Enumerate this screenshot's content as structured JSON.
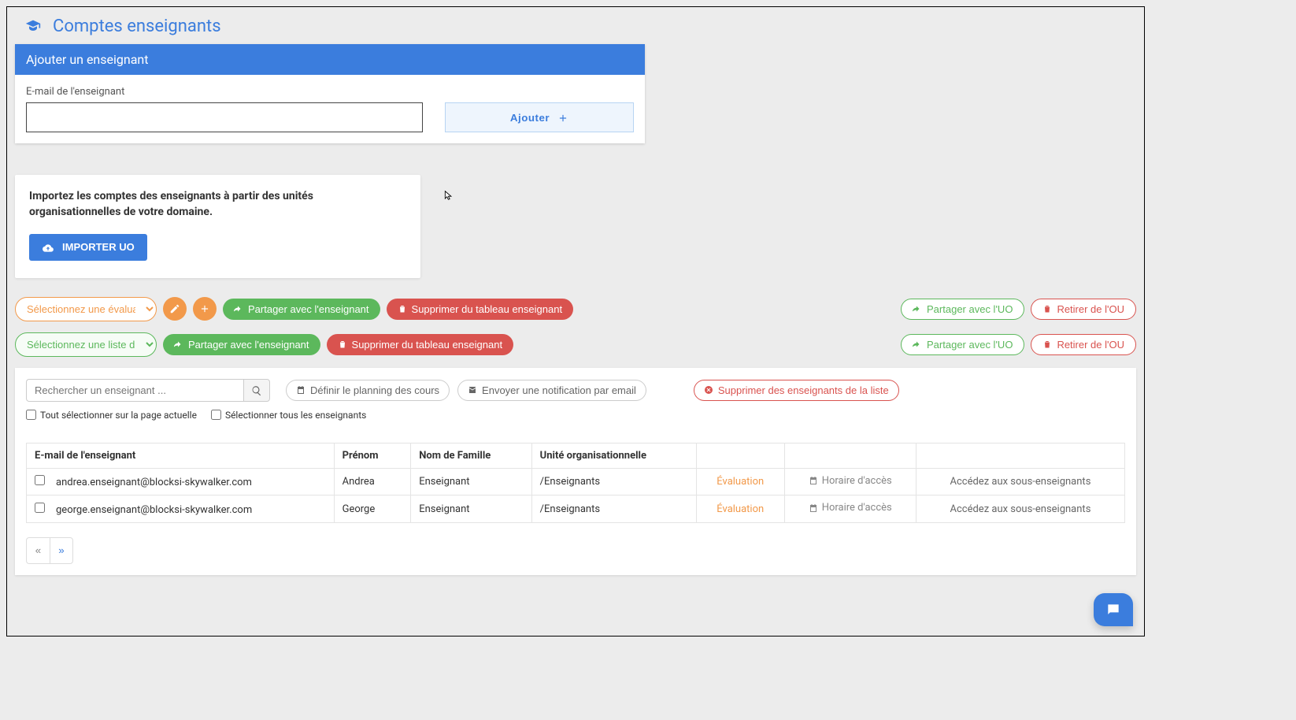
{
  "page": {
    "title": "Comptes enseignants"
  },
  "add_card": {
    "header": "Ajouter un enseignant",
    "field_label": "E-mail de l'enseignant",
    "button": "Ajouter"
  },
  "import_card": {
    "text": "Importez les comptes des enseignants à partir des unités organisationnelles de votre domaine.",
    "button": "IMPORTER UO"
  },
  "row1": {
    "select_label": "Sélectionnez une évaluation",
    "share_teacher": "Partager avec l'enseignant",
    "remove_teacher": "Supprimer du tableau enseignant",
    "share_uo": "Partager avec l'UO",
    "remove_ou": "Retirer de l'OU"
  },
  "row2": {
    "select_label": "Sélectionnez une liste d'e...",
    "share_teacher": "Partager avec l'enseignant",
    "remove_teacher": "Supprimer du tableau enseignant",
    "share_uo": "Partager avec l'UO",
    "remove_ou": "Retirer de l'OU"
  },
  "toolbar": {
    "search_placeholder": "Rechercher un enseignant ...",
    "define_planning": "Définir le planning des cours",
    "send_notification": "Envoyer une notification par email",
    "delete_list": "Supprimer des enseignants de la liste"
  },
  "checks": {
    "select_page": "Tout sélectionner sur la page actuelle",
    "select_all": "Sélectionner tous les enseignants"
  },
  "table": {
    "headers": {
      "email": "E-mail de l'enseignant",
      "firstname": "Prénom",
      "lastname": "Nom de Famille",
      "ou": "Unité organisationnelle"
    },
    "eval_label": "Évaluation",
    "access_label": "Horaire d'accès",
    "sub_label": "Accédez aux sous-enseignants",
    "rows": [
      {
        "email": "andrea.enseignant@blocksi-skywalker.com",
        "first": "Andrea",
        "last": "Enseignant",
        "ou": "/Enseignants"
      },
      {
        "email": "george.enseignant@blocksi-skywalker.com",
        "first": "George",
        "last": "Enseignant",
        "ou": "/Enseignants"
      }
    ]
  },
  "pager": {
    "prev": "«",
    "next": "»"
  }
}
